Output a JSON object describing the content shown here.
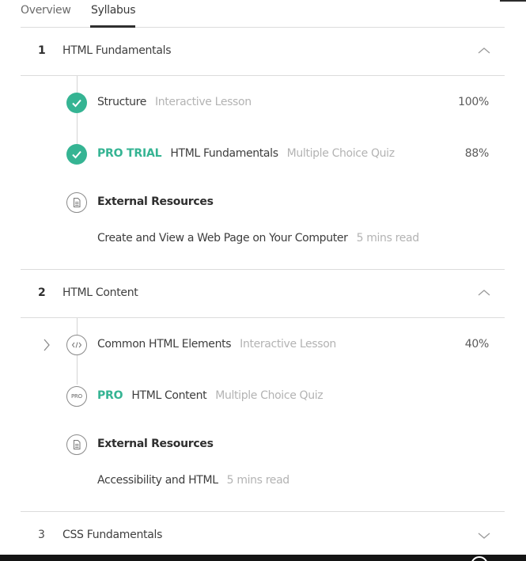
{
  "tabs": [
    {
      "label": "Overview",
      "active": false
    },
    {
      "label": "Syllabus",
      "active": true
    }
  ],
  "colors": {
    "accent": "#35b493",
    "text": "#3d3d3d",
    "muted": "#b3b3b3"
  },
  "sections": [
    {
      "number": "1",
      "title": "HTML Fundamentals",
      "expanded": true,
      "items": [
        {
          "icon": "check-icon",
          "title": "Structure",
          "type": "Interactive Lesson",
          "percent": "100%"
        },
        {
          "icon": "check-icon",
          "tag": "PRO TRIAL",
          "title": "HTML Fundamentals",
          "type": "Multiple Choice Quiz",
          "percent": "88%"
        },
        {
          "icon": "document-icon",
          "title": "External Resources"
        }
      ],
      "resource": {
        "title": "Create and View a Web Page on Your Computer",
        "duration": "5 mins read"
      }
    },
    {
      "number": "2",
      "title": "HTML Content",
      "expanded": true,
      "items": [
        {
          "icon": "code-icon",
          "title": "Common HTML Elements",
          "type": "Interactive Lesson",
          "percent": "40%"
        },
        {
          "icon": "pro-icon",
          "icon_text": "PRO",
          "tag": "PRO",
          "title": "HTML Content",
          "type": "Multiple Choice Quiz"
        },
        {
          "icon": "document-icon",
          "title": "External Resources"
        }
      ],
      "resource": {
        "title": "Accessibility and HTML",
        "duration": "5 mins read"
      }
    },
    {
      "number": "3",
      "title": "CSS Fundamentals",
      "expanded": false
    }
  ]
}
